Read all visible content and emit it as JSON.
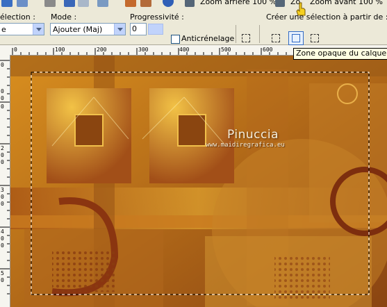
{
  "toolbar_top": {
    "zoom_out_label": "Zoom arrière 100 %",
    "zoom_in_label": "Zoom avant 100 %",
    "zoom_in_prefix": "Zo"
  },
  "options": {
    "selection_label": "élection :",
    "mode_label": "Mode :",
    "mode_value": "Ajouter (Maj)",
    "progressivity_label": "Progressivité :",
    "progressivity_value": "0",
    "antialias_label": "Anticrénelage",
    "create_selection_label": "Créer une sélection à partir de :",
    "selection_value": "e"
  },
  "tooltip": {
    "text": "Zone opaque du calque"
  },
  "ruler_h": [
    "0",
    "100",
    "200",
    "300",
    "400",
    "500",
    "600"
  ],
  "ruler_v": [
    "0",
    "0",
    "0",
    "0",
    "2",
    "0",
    "0",
    "3",
    "0",
    "0",
    "4",
    "0",
    "0",
    "5",
    "0"
  ],
  "watermark": {
    "title": "Pinuccia",
    "url": "www.maidiregrafica.eu"
  },
  "colors": {
    "accent": "#316ac5",
    "canvas_bg": "#b66d12",
    "tooltip_bg": "#ffffe1"
  }
}
